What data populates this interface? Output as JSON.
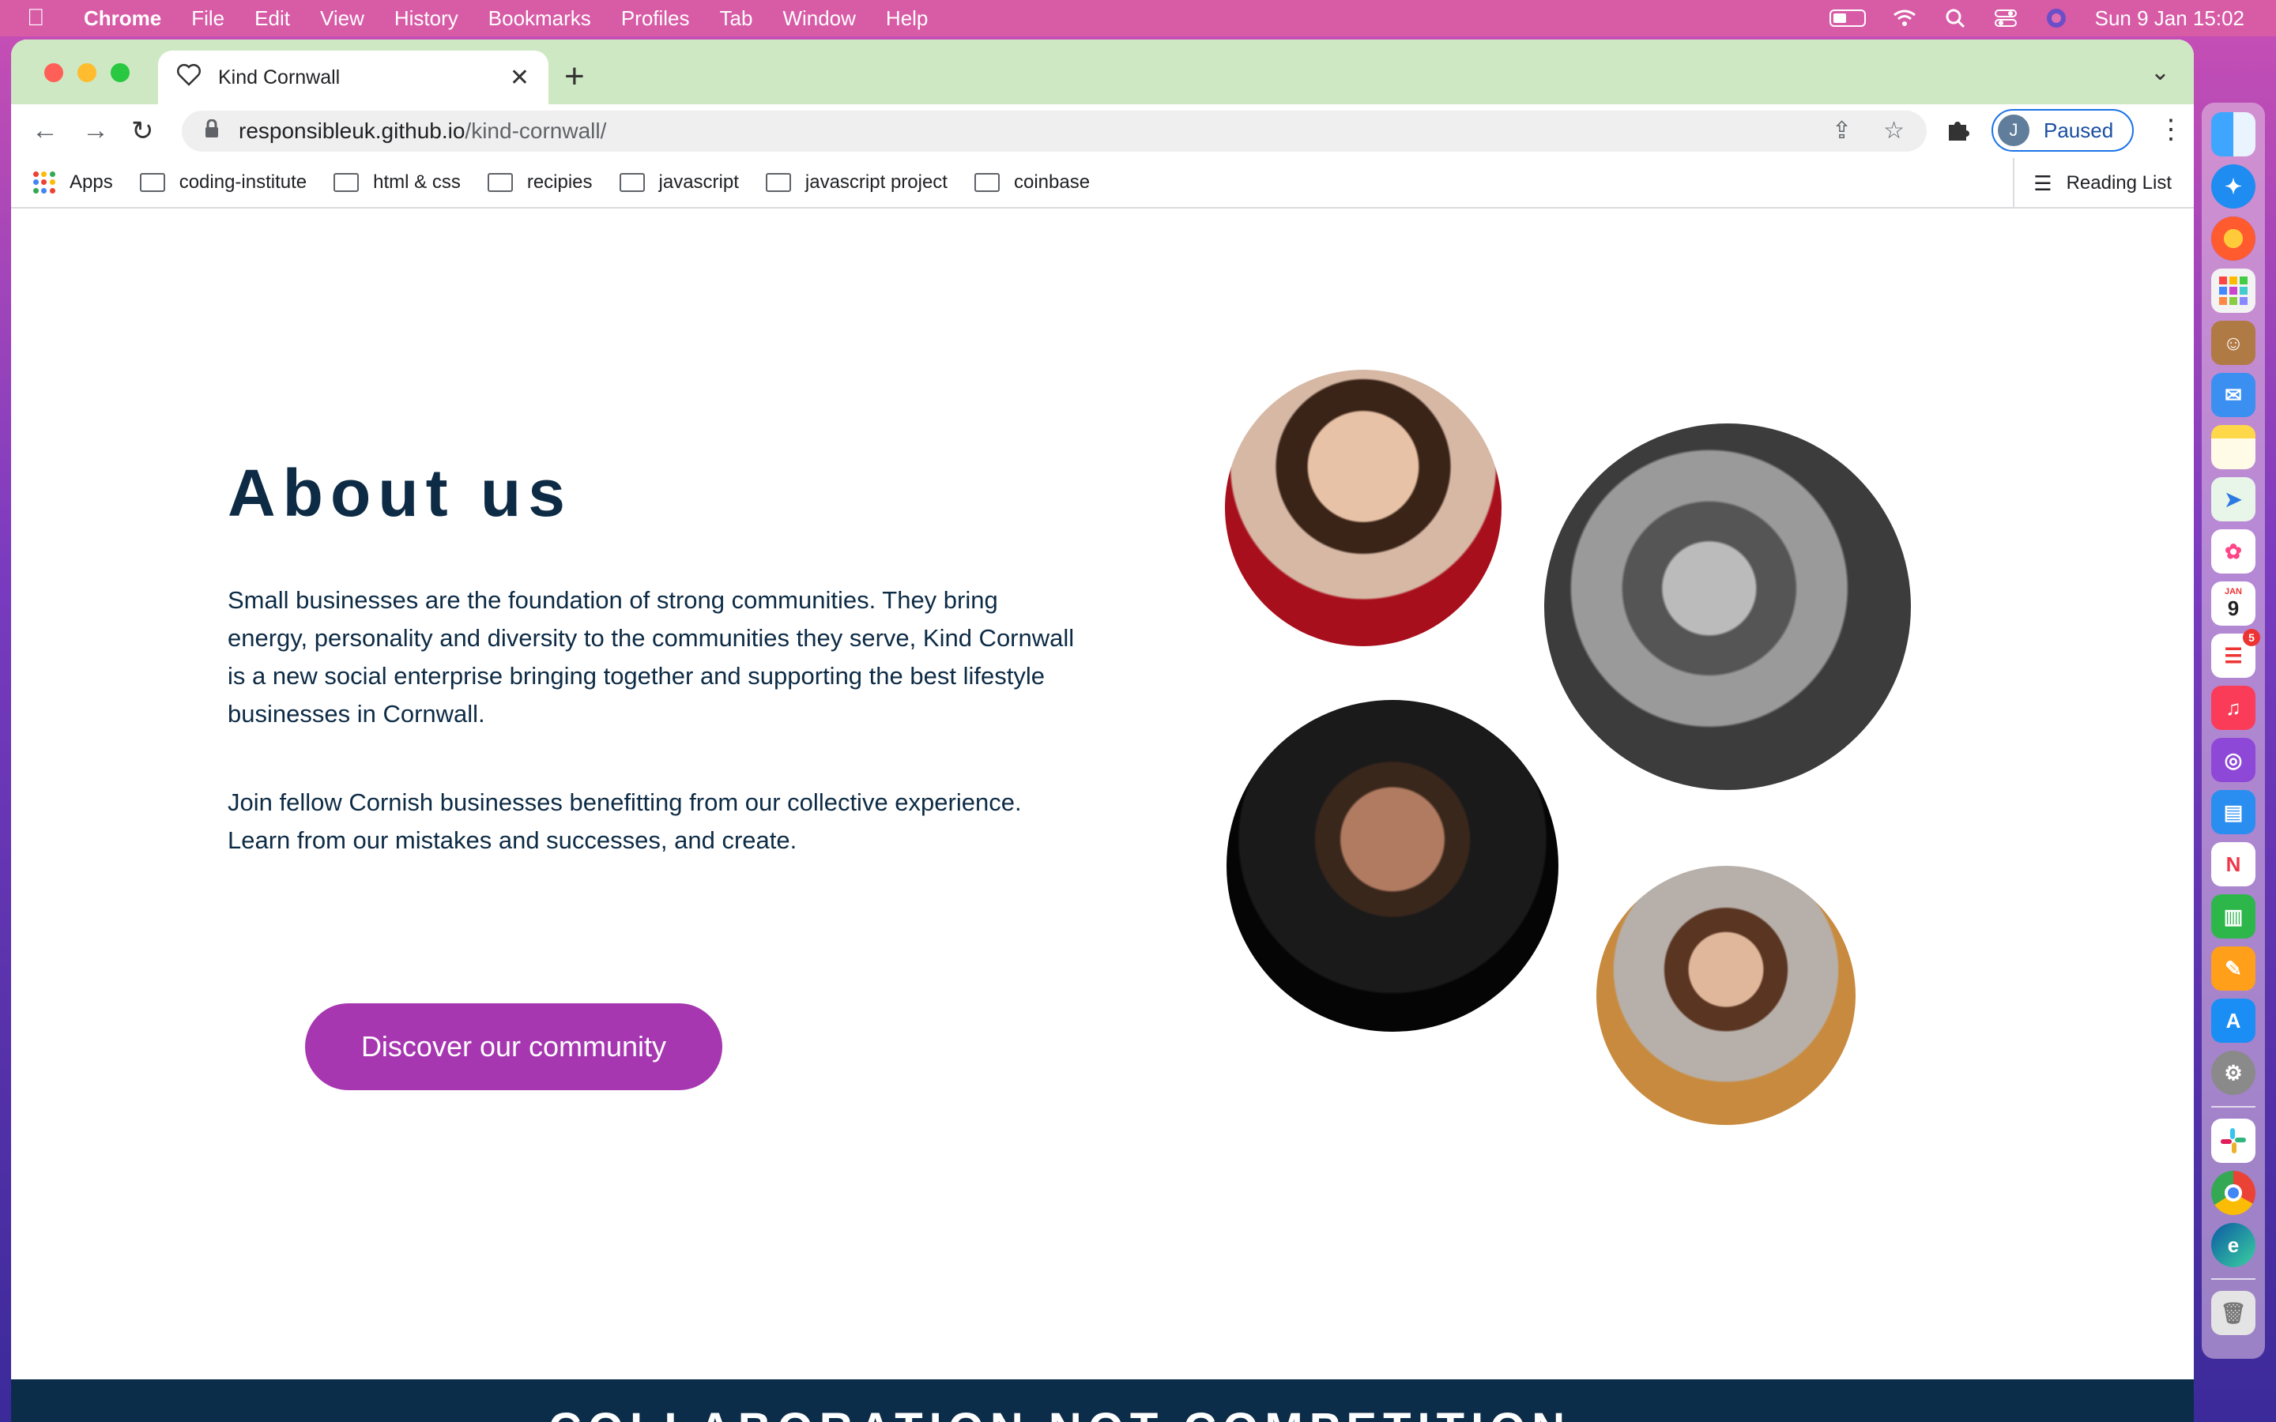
{
  "menubar": {
    "app_name": "Chrome",
    "menus": [
      "File",
      "Edit",
      "View",
      "History",
      "Bookmarks",
      "Profiles",
      "Tab",
      "Window",
      "Help"
    ],
    "datetime": "Sun 9 Jan  15:02"
  },
  "browser": {
    "tab_title": "Kind Cornwall",
    "url_host": "responsibleuk.github.io",
    "url_path": "/kind-cornwall/",
    "profile_initial": "J",
    "profile_status": "Paused",
    "bookmarks": [
      "Apps",
      "coding-institute",
      "html & css",
      "recipies",
      "javascript",
      "javascript project",
      "coinbase"
    ],
    "reading_list": "Reading List"
  },
  "page": {
    "heading": "About us",
    "paragraph1": "Small businesses are the foundation of strong communities. They bring energy, personality and diversity to the communities they serve, Kind Cornwall is a new social enterprise bringing together and supporting the best lifestyle businesses in Cornwall.",
    "paragraph2": "Join fellow Cornish businesses benefitting from our collective experience. Learn from our mistakes and successes, and create.",
    "cta_label": "Discover our community",
    "banner_text": "COLLABORATION NOT COMPETITION"
  },
  "dock": {
    "calendar_day": "9",
    "calendar_month": "JAN",
    "reminders_badge": "5"
  },
  "colors": {
    "accent": "#a637b0",
    "heading": "#0d2b45",
    "banner": "#0c2d4a",
    "tabstrip": "#cfe8c4"
  }
}
